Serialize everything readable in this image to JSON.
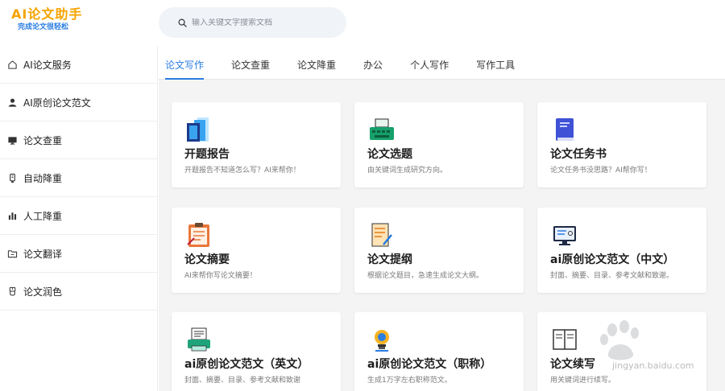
{
  "logo": {
    "title": "AI论文助手",
    "subtitle": "完成论文很轻松"
  },
  "search": {
    "placeholder": "输入关键文字搜索文档"
  },
  "sidebar": {
    "items": [
      {
        "label": "AI论文服务",
        "icon": "home-icon"
      },
      {
        "label": "AI原创论文范文",
        "icon": "user-icon"
      },
      {
        "label": "论文查重",
        "icon": "monitor-icon"
      },
      {
        "label": "自动降重",
        "icon": "device-icon"
      },
      {
        "label": "人工降重",
        "icon": "bar-chart-icon"
      },
      {
        "label": "论文翻译",
        "icon": "folder-icon"
      },
      {
        "label": "论文润色",
        "icon": "brush-icon"
      }
    ]
  },
  "tabs": [
    {
      "label": "论文写作",
      "active": true
    },
    {
      "label": "论文查重",
      "active": false
    },
    {
      "label": "论文降重",
      "active": false
    },
    {
      "label": "办公",
      "active": false
    },
    {
      "label": "个人写作",
      "active": false
    },
    {
      "label": "写作工具",
      "active": false
    }
  ],
  "cards": [
    {
      "title": "开题报告",
      "desc": "开题报告不知道怎么写？AI来帮你！",
      "icon": "report-icon"
    },
    {
      "title": "论文选题",
      "desc": "由关键词生成研究方向。",
      "icon": "typewriter-icon"
    },
    {
      "title": "论文任务书",
      "desc": "论文任务书没思路？AI帮你写！",
      "icon": "book-icon"
    },
    {
      "title": "论文摘要",
      "desc": "AI来帮你写论文摘要！",
      "icon": "clipboard-icon"
    },
    {
      "title": "论文提纲",
      "desc": "根据论文题目，急速生成论文大纲。",
      "icon": "outline-icon"
    },
    {
      "title": "ai原创论文范文（中文）",
      "desc": "封面、摘要、目录、参考文献和致谢。",
      "icon": "screen-icon"
    },
    {
      "title": "ai原创论文范文（英文）",
      "desc": "封面、摘要、目录、参考文献和致谢",
      "icon": "printer-icon"
    },
    {
      "title": "ai原创论文范文（职称）",
      "desc": "生成1万字左右职称范文。",
      "icon": "bulb-icon"
    },
    {
      "title": "论文续写",
      "desc": "用关键词进行续写。",
      "icon": "notebook-icon"
    }
  ],
  "watermark": {
    "text": "jingyan.baidu.com"
  },
  "colors": {
    "accent": "#2a7de1",
    "logo": "#f5a300"
  }
}
